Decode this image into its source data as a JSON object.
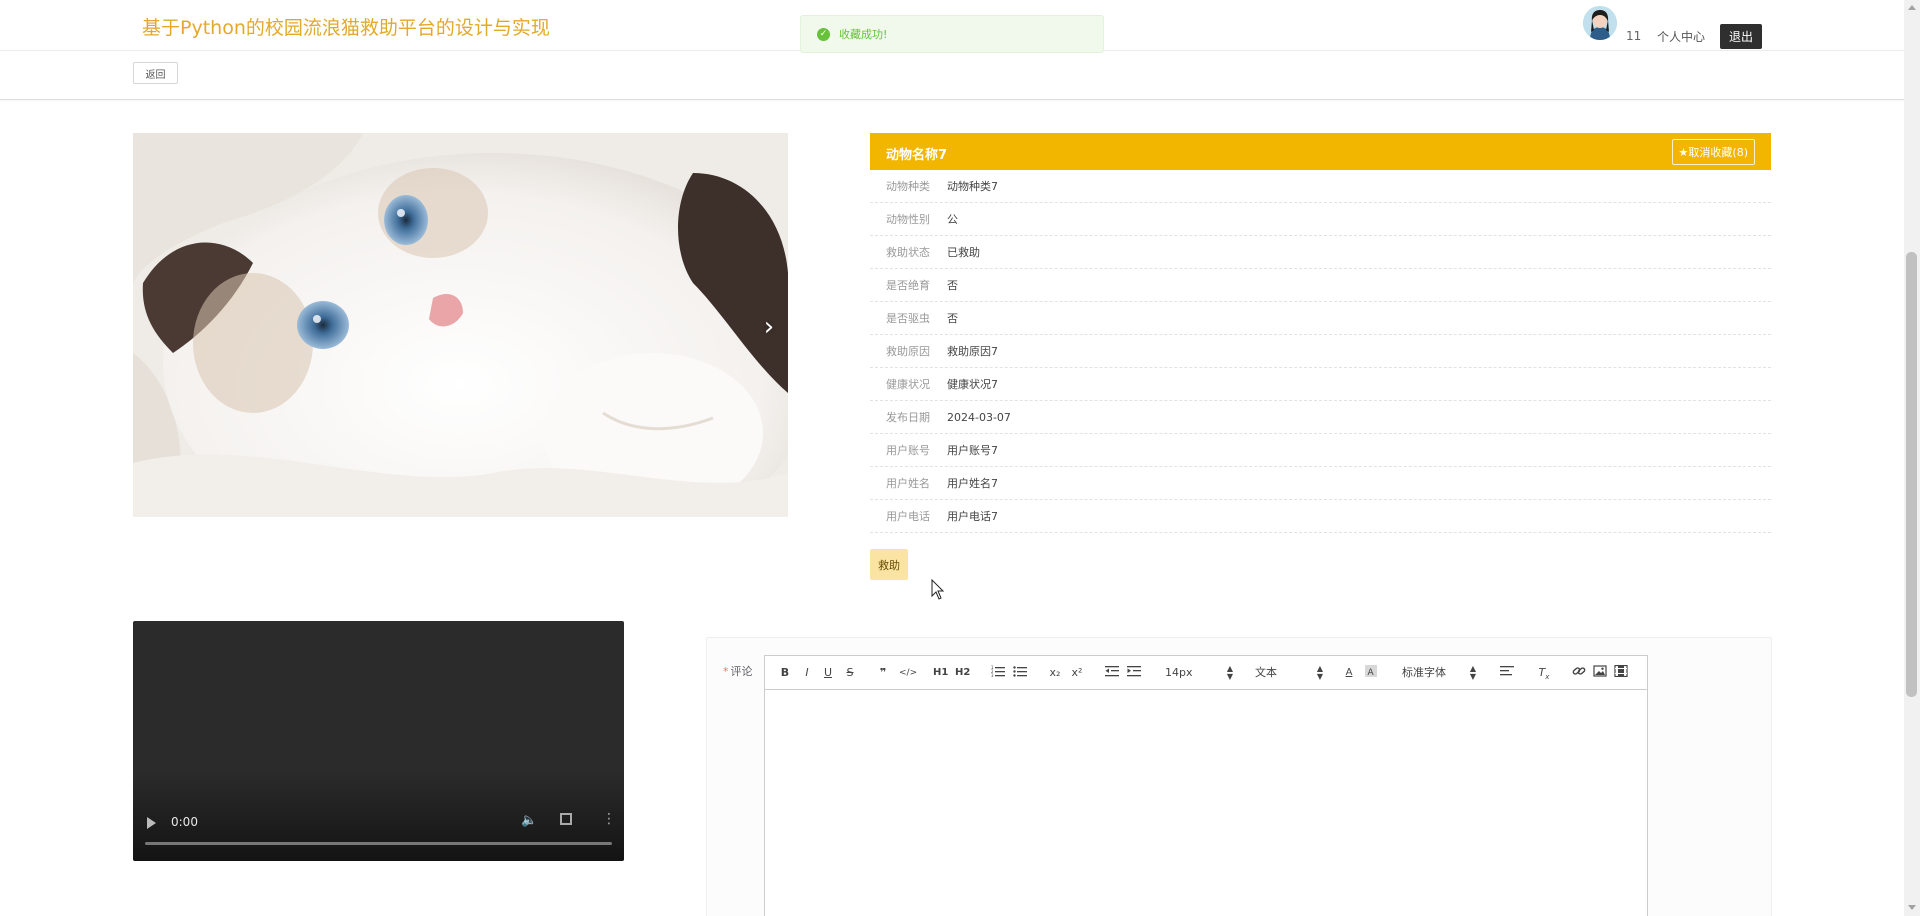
{
  "header": {
    "title": "基于Python的校园流浪猫救助平台的设计与实现",
    "user_name": "11",
    "personal_center": "个人中心",
    "logout": "退出"
  },
  "nav": {
    "back": "返回"
  },
  "toast": {
    "message": "收藏成功!",
    "icon": "check-circle-icon",
    "color": "#67c23a"
  },
  "carousel": {
    "next_icon": "chevron-right-icon"
  },
  "detail": {
    "name": "动物名称7",
    "favorite_button": "★取消收藏(8)",
    "accent_color": "#f3b600",
    "fields": [
      {
        "label": "动物种类",
        "value": "动物种类7"
      },
      {
        "label": "动物性别",
        "value": "公"
      },
      {
        "label": "救助状态",
        "value": "已救助"
      },
      {
        "label": "是否绝育",
        "value": "否"
      },
      {
        "label": "是否驱虫",
        "value": "否"
      },
      {
        "label": "救助原因",
        "value": "救助原因7"
      },
      {
        "label": "健康状况",
        "value": "健康状况7"
      },
      {
        "label": "发布日期",
        "value": "2024-03-07"
      },
      {
        "label": "用户账号",
        "value": "用户账号7"
      },
      {
        "label": "用户姓名",
        "value": "用户姓名7"
      },
      {
        "label": "用户电话",
        "value": "用户电话7"
      }
    ],
    "rescue_button": "救助"
  },
  "video": {
    "time": "0:00"
  },
  "comment": {
    "required_mark": "*",
    "label": "评论",
    "toolbar": {
      "bold": "B",
      "italic": "I",
      "underline": "U",
      "strike": "S",
      "blockquote": "❞",
      "code": "</>",
      "h1": "H1",
      "h2": "H2",
      "subscript": "x₂",
      "superscript": "x²",
      "font_size": "14px",
      "header_select": "文本",
      "font_family": "标准字体"
    }
  }
}
